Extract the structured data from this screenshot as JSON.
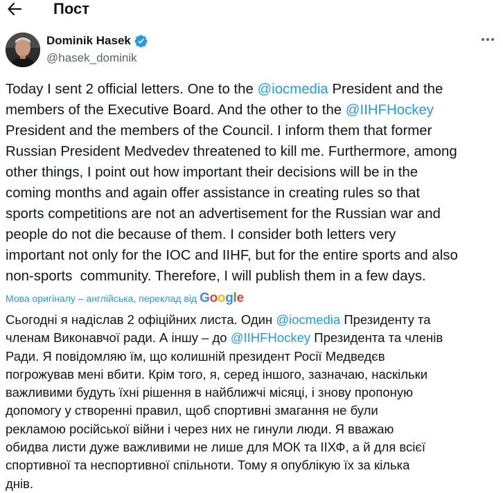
{
  "header": {
    "title": "Пост"
  },
  "author": {
    "display_name": "Dominik Hasek",
    "handle": "@hasek_dominik",
    "verified": true
  },
  "tweet": {
    "lines": [
      [
        {
          "t": "Today I sent 2 official letters. One to the "
        },
        {
          "t": "@iocmedia",
          "m": true
        },
        {
          "t": " President and the"
        }
      ],
      [
        {
          "t": "members of the Executive Board. And the other to the "
        },
        {
          "t": "@IIHFHockey",
          "m": true
        }
      ],
      [
        {
          "t": "President and the members of the Council. I inform them that former"
        }
      ],
      [
        {
          "t": "Russian President Medvedev threatened to kill me. Furthermore, among"
        }
      ],
      [
        {
          "t": "other things, I point out how important their decisions will be in the"
        }
      ],
      [
        {
          "t": "coming months and again offer assistance in creating rules so that"
        }
      ],
      [
        {
          "t": "sports competitions are not an advertisement for the Russian war and"
        }
      ],
      [
        {
          "t": "people do not die because of them. I consider both letters very"
        }
      ],
      [
        {
          "t": "important not only for the IOC and IIHF, but for the entire sports and also"
        }
      ],
      [
        {
          "t": "non-sports  community. Therefore, I will publish them in a few days."
        }
      ]
    ]
  },
  "translation": {
    "label": "Мова оригіналу – англійська, переклад від",
    "provider": "Google",
    "lines": [
      [
        {
          "t": "Сьогодні я надіслав 2 офіційних листа. Один "
        },
        {
          "t": "@iocmedia",
          "m": true
        },
        {
          "t": " Президенту та"
        }
      ],
      [
        {
          "t": "членам Виконавчої ради. А іншу – до "
        },
        {
          "t": "@IIHFHockey",
          "m": true
        },
        {
          "t": " Президента та членів"
        }
      ],
      [
        {
          "t": "Ради. Я повідомляю їм, що колишній президент Росії Медведєв"
        }
      ],
      [
        {
          "t": "погрожував мені вбити. Крім того, я, серед іншого, зазначаю, наскільки"
        }
      ],
      [
        {
          "t": "важливими будуть їхні рішення в найближчі місяці, і знову пропоную"
        }
      ],
      [
        {
          "t": "допомогу у створенні правил, щоб спортивні змагання не були"
        }
      ],
      [
        {
          "t": "рекламою російської війни і через них не гинули люди. Я вважаю"
        }
      ],
      [
        {
          "t": "обидва листи дуже важливими не лише для МОК та ІІХФ, а й для всієї"
        }
      ],
      [
        {
          "t": "спортивної та неспортивної спільноти. Тому я опублікую їх за кілька"
        }
      ],
      [
        {
          "t": "днів."
        }
      ]
    ]
  },
  "colors": {
    "accent": "#1d9bf0",
    "text": "#0f1419",
    "secondary_text": "#536471",
    "google_blue": "#4285f4",
    "google_red": "#ea4335",
    "google_yellow": "#fbbc05",
    "google_green": "#34a853"
  },
  "icons": {
    "back": "arrow-left-icon",
    "verified": "verified-badge-icon",
    "more": "more-horizontal-icon"
  }
}
